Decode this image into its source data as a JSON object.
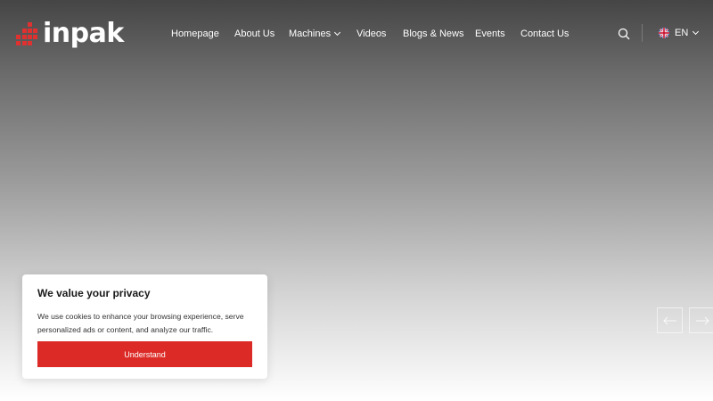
{
  "header": {
    "logo_text": "inpak",
    "nav": [
      {
        "label": "Homepage"
      },
      {
        "label": "About Us"
      },
      {
        "label": "Machines"
      },
      {
        "label": "Videos"
      },
      {
        "label": "Blogs & News"
      },
      {
        "label": "Events"
      },
      {
        "label": "Contact Us"
      }
    ],
    "language": "EN"
  },
  "colors": {
    "accent": "#dc2b27",
    "logo_red": "#e03131",
    "text_light": "#ffffff"
  },
  "cookie": {
    "title": "We value your privacy",
    "text": "We use cookies to enhance your browsing experience, serve personalized ads or content, and analyze our traffic.",
    "button_label": "Understand"
  },
  "icons": {
    "search": "search-icon",
    "language_flag": "uk-flag-icon",
    "slider_prev": "arrow-left-icon",
    "slider_next": "arrow-right-icon"
  }
}
